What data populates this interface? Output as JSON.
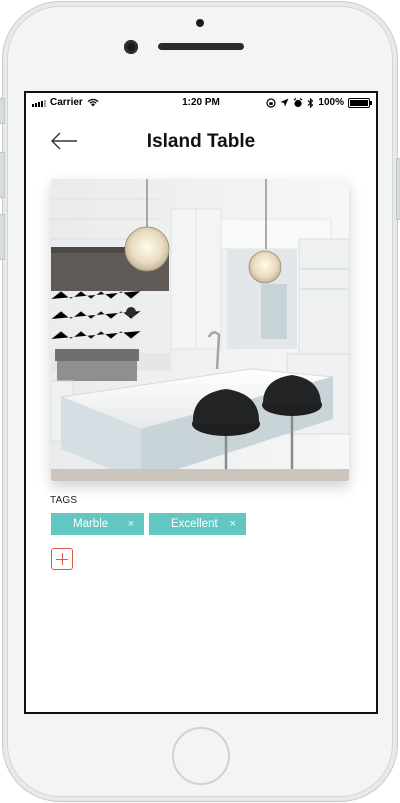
{
  "status_bar": {
    "carrier": "Carrier",
    "time": "1:20 PM",
    "battery_percent": "100%",
    "battery_level": 1.0,
    "icons": [
      "signal-icon",
      "wifi-icon",
      "lock-rotation-icon",
      "location-icon",
      "alarm-icon",
      "bluetooth-icon",
      "battery-icon"
    ]
  },
  "navbar": {
    "title": "Island Table",
    "back_icon": "arrow-left-icon"
  },
  "photo": {
    "subject": "kitchen-island-photo"
  },
  "tags": {
    "label": "TAGS",
    "items": [
      {
        "label": "Marble",
        "remove_symbol": "×"
      },
      {
        "label": "Excellent",
        "remove_symbol": "×"
      }
    ],
    "add_icon": "plus-icon",
    "tag_color": "#63c7c1",
    "add_color": "#e2554f"
  }
}
